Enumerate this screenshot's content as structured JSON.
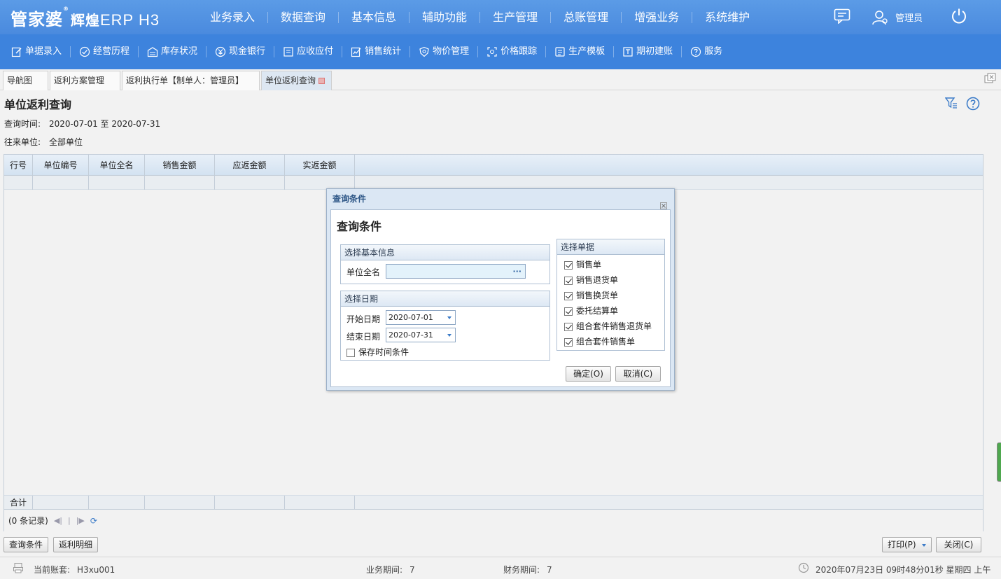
{
  "app": {
    "logo_main": "管家婆",
    "logo_mark": "®",
    "logo_sub": "辉煌",
    "logo_product": "ERP H3"
  },
  "main_nav": [
    "业务录入",
    "数据查询",
    "基本信息",
    "辅助功能",
    "生产管理",
    "总账管理",
    "增强业务",
    "系统维护"
  ],
  "user": {
    "name": "管理员"
  },
  "sub_nav": [
    {
      "label": "单据录入",
      "icon": "edit-icon"
    },
    {
      "label": "经营历程",
      "icon": "check-circle-icon"
    },
    {
      "label": "库存状况",
      "icon": "warehouse-icon"
    },
    {
      "label": "现金银行",
      "icon": "yen-icon"
    },
    {
      "label": "应收应付",
      "icon": "ledger-icon"
    },
    {
      "label": "销售统计",
      "icon": "chart-edit-icon"
    },
    {
      "label": "物价管理",
      "icon": "shield-icon"
    },
    {
      "label": "价格跟踪",
      "icon": "target-icon"
    },
    {
      "label": "生产模板",
      "icon": "template-icon"
    },
    {
      "label": "期初建账",
      "icon": "account-icon"
    },
    {
      "label": "服务",
      "icon": "help-circle-icon"
    }
  ],
  "tabs": [
    {
      "label": "导航图"
    },
    {
      "label": "返利方案管理"
    },
    {
      "label": "返利执行单【制单人：管理员】"
    },
    {
      "label": "单位返利查询",
      "active": true
    }
  ],
  "page": {
    "title": "单位返利查询",
    "query_time_label": "查询时间:",
    "query_time_value": "2020-07-01 至 2020-07-31",
    "unit_label": "往来单位:",
    "unit_value": "全部单位"
  },
  "grid": {
    "columns": [
      "行号",
      "单位编号",
      "单位全名",
      "销售金额",
      "应返金额",
      "实返金额"
    ],
    "footer_label": "合计",
    "record_count": "(0 条记录)"
  },
  "buttons": {
    "query_conditions": "查询条件",
    "rebate_detail": "返利明细",
    "print": "打印(P)",
    "close": "关闭(C)"
  },
  "status": {
    "account_label": "当前账套:",
    "account_value": "H3xu001",
    "biz_period_label": "业务期间:",
    "biz_period_value": "7",
    "fin_period_label": "财务期间:",
    "fin_period_value": "7",
    "datetime": "2020年07月23日 09时48分01秒 星期四 上午"
  },
  "dialog": {
    "window_title": "查询条件",
    "heading": "查询条件",
    "basic_legend": "选择基本信息",
    "unit_name_label": "单位全名",
    "unit_name_value": "",
    "unit_browse": "···",
    "date_legend": "选择日期",
    "start_label": "开始日期",
    "start_value": "2020-07-01",
    "end_label": "结束日期",
    "end_value": "2020-07-31",
    "save_time_label": "保存时间条件",
    "save_time_checked": false,
    "docs_legend": "选择单据",
    "docs": [
      {
        "label": "销售单",
        "checked": true
      },
      {
        "label": "销售退货单",
        "checked": true
      },
      {
        "label": "销售换货单",
        "checked": true
      },
      {
        "label": "委托结算单",
        "checked": true
      },
      {
        "label": "组合套件销售退货单",
        "checked": true
      },
      {
        "label": "组合套件销售单",
        "checked": true
      }
    ],
    "ok": "确定(O)",
    "cancel": "取消(C)"
  },
  "colors": {
    "topbar": "#4a8ade",
    "subbar": "#3d83dd",
    "grid_header": "#d3e2f1",
    "dialog_frame": "#dbe7f4"
  }
}
